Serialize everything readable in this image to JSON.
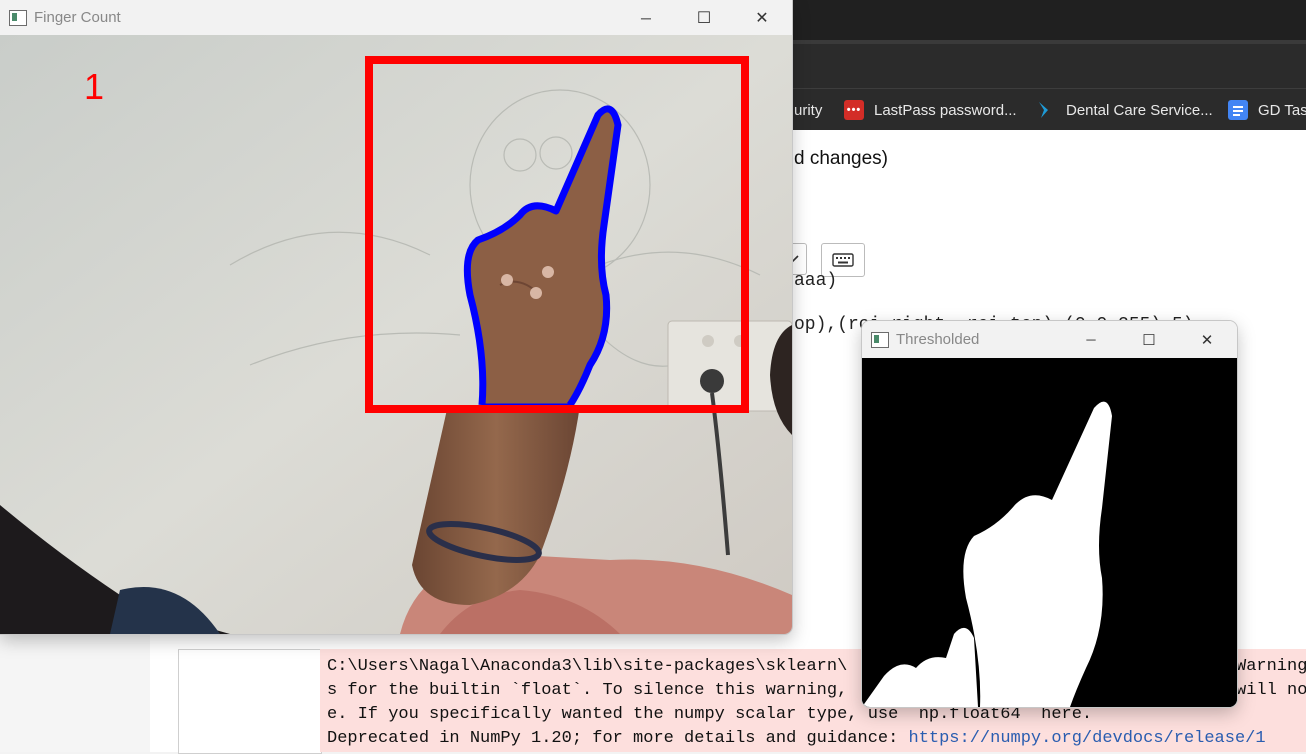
{
  "browser": {
    "bookmarks": [
      {
        "label": "urity",
        "icon": "shield-icon"
      },
      {
        "label": "LastPass password...",
        "icon": "lastpass-icon",
        "color": "#d32d27"
      },
      {
        "label": "Dental Care Service...",
        "icon": "dental-icon",
        "color": "#1e9bd7"
      },
      {
        "label": "GD Task",
        "icon": "gd-docs-icon",
        "color": "#4285f4"
      }
    ]
  },
  "notebook": {
    "title_fragment": "d changes)",
    "menu_fragment": ")",
    "code_fragments": [
      "aaa)",
      "op),(roi_right, roi_top),(0,0,255),5)"
    ]
  },
  "stderr": {
    "lines": [
      "C:\\Users\\Nagal\\Anaconda3\\lib\\site-packages\\sklearn\\",
      "s for the builtin `float`. To silence this warning,",
      "e. If you specifically wanted the numpy scalar type, use `np.float64` here.",
      "Deprecated in NumPy 1.20; for more details and guidance: "
    ],
    "line1_right": "Warning",
    "line2_right": "will no",
    "link_text": "https://numpy.org/devdocs/release/1"
  },
  "finger_window": {
    "title": "Finger Count",
    "finger_count": "1",
    "count_color": "#ff0000",
    "roi_color": "#ff0000",
    "contour_color": "#0000ff"
  },
  "thresh_window": {
    "title": "Thresholded"
  },
  "window_controls": {
    "minimize": "─",
    "maximize": "☐",
    "close": "✕"
  }
}
